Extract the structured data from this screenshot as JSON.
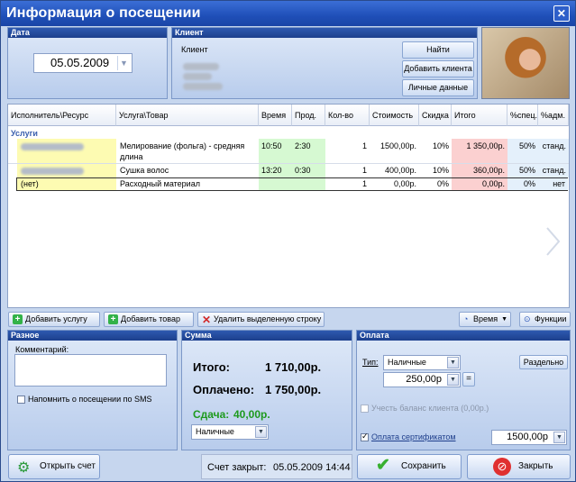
{
  "title": "Информация о посещении",
  "date_panel": {
    "header": "Дата",
    "date": "05.05.2009"
  },
  "client_panel": {
    "header": "Клиент",
    "label": "Клиент",
    "find": "Найти",
    "add": "Добавить клиента",
    "personal": "Личные данные"
  },
  "grid": {
    "headers": [
      "Исполнитель\\Ресурс",
      "Услуга\\Товар",
      "Время",
      "Прод.",
      "Кол-во",
      "Стоимость",
      "Скидка",
      "Итого",
      "%спец.",
      "%адм."
    ],
    "section": "Услуги",
    "rows": [
      {
        "service": "Мелирование (фольга) - средняя",
        "service2": "длина",
        "time": "10:50",
        "dur": "2:30",
        "qty": "1",
        "cost": "1500,00р.",
        "disc": "10%",
        "total": "1 350,00р.",
        "spec": "50%",
        "adm": "станд."
      },
      {
        "service": "Сушка волос",
        "service2": "",
        "time": "13:20",
        "dur": "0:30",
        "qty": "1",
        "cost": "400,00р.",
        "disc": "10%",
        "total": "360,00р.",
        "spec": "50%",
        "adm": "станд."
      },
      {
        "performer": "(нет)",
        "service": "Расходный материал",
        "service2": "",
        "time": "",
        "dur": "",
        "qty": "1",
        "cost": "0,00р.",
        "disc": "0%",
        "total": "0,00р.",
        "spec": "0%",
        "adm": "нет"
      }
    ]
  },
  "actions": {
    "add_service": "Добавить услугу",
    "add_product": "Добавить товар",
    "delete_row": "Удалить выделенную строку",
    "time": "Время",
    "functions": "Функции"
  },
  "misc_panel": {
    "header": "Разное",
    "comment_label": "Комментарий:",
    "sms": "Напомнить о посещении по SMS"
  },
  "sum_panel": {
    "header": "Сумма",
    "total_label": "Итого:",
    "total": "1 710,00р.",
    "paid_label": "Оплачено:",
    "paid": "1 750,00р.",
    "change_label": "Сдача:",
    "change": "40,00р.",
    "method": "Наличные"
  },
  "pay_panel": {
    "header": "Оплата",
    "type_label": "Тип:",
    "type": "Наличные",
    "separately": "Раздельно",
    "amount": "250,00р",
    "eq": "=",
    "balance": "Учесть баланс клиента (0,00р.)",
    "cert": "Оплата сертификатом",
    "cert_amount": "1500,00р"
  },
  "footer": {
    "open_bill": "Открыть счет",
    "closed_label": "Счет закрыт:",
    "closed_at": "05.05.2009 14:44",
    "save": "Сохранить",
    "close": "Закрыть"
  },
  "colors": {
    "accent": "#1f4fb8",
    "green": "#1e9a1e"
  }
}
